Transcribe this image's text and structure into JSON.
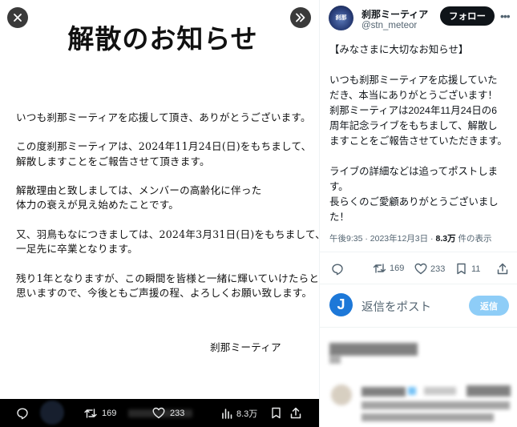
{
  "viewer": {
    "close_icon": "close-icon",
    "expand_icon": "double-chevron-right-icon",
    "document": {
      "title": "解散のお知らせ",
      "lines": [
        "いつも刹那ミーティアを応援して頂き、ありがとうございます。",
        "この度刹那ミーティアは、2024年11月24日(日)をもちまして、",
        "解散しますことをご報告させて頂きます。",
        "解散理由と致しましては、メンバーの高齢化に伴った",
        "体力の衰えが見え始めたことです。",
        "又、羽鳥もなにつきましては、2024年3月31日(日)をもちまして、",
        "一足先に卒業となります。",
        "残り1年となりますが、この瞬間を皆様と一緒に輝いていけたらと",
        "思いますので、今後ともご声援の程、よろしくお願い致します。"
      ],
      "signature": "刹那ミーティア"
    },
    "bottom_bar": {
      "retweets": "169",
      "likes": "233",
      "views": "8.3万"
    }
  },
  "tweet": {
    "display_name": "刹那ミーティア",
    "handle": "@stn_meteor",
    "avatar_text": "刹那",
    "follow_label": "フォロー",
    "more_icon": "more-icon",
    "body_lines": [
      "【みなさまに大切なお知らせ】",
      "いつも刹那ミーティアを応援していた",
      "だき、本当にありがとうございます！",
      "刹那ミーティアは2024年11月24日の6",
      "周年記念ライブをもちまして、解散し",
      "ますことをご報告させていただきます。",
      "ライブの詳細などは追ってポストしま",
      "す。",
      "長らくのご愛顧ありがとうございまし",
      "た！"
    ],
    "timestamp": "午後9:35 · 2023年12月3日 · ",
    "views_count": "8.3万",
    "views_suffix": " 件の表示",
    "actions": {
      "retweets": "169",
      "likes": "233",
      "bookmarks": "11"
    },
    "reply_avatar_letter": "J",
    "reply_placeholder": "返信をポスト",
    "reply_button": "返信"
  }
}
